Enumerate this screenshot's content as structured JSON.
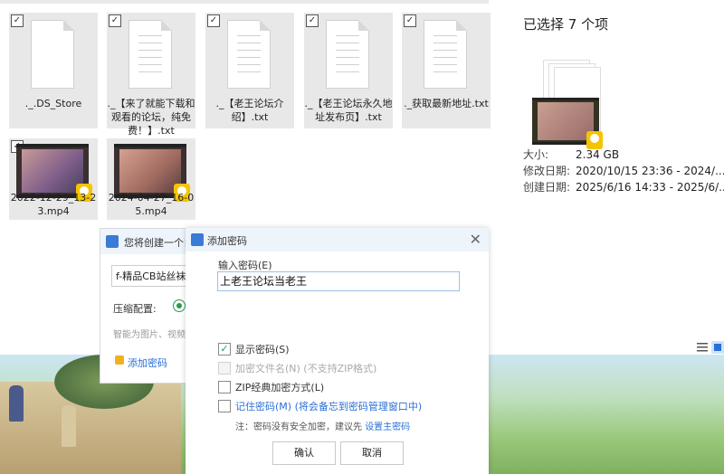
{
  "files": [
    {
      "name": "._.DS_Store",
      "type": "doc"
    },
    {
      "name": "._【来了就能下载和观看的论坛，纯免费！】.txt",
      "type": "doc"
    },
    {
      "name": "._【老王论坛介绍】.txt",
      "type": "doc"
    },
    {
      "name": "._【老王论坛永久地址发布页】.txt",
      "type": "doc"
    },
    {
      "name": "._获取最新地址.txt",
      "type": "doc"
    },
    {
      "name": "2022-12-29_13-23.mp4",
      "type": "video"
    },
    {
      "name": "2024-04-27_16-05.mp4",
      "type": "video"
    }
  ],
  "details": {
    "title": "已选择 7 个项",
    "size_label": "大小:",
    "size_value": "2.34 GB",
    "modified_label": "修改日期:",
    "modified_value": "2020/10/15 23:36 - 2024/...",
    "created_label": "创建日期:",
    "created_value": "2025/6/16 14:33 - 2025/6/..."
  },
  "archive_dialog": {
    "title": "您将创建一个日",
    "filename": "f-精品CB站丝袜",
    "compress_label": "压缩配置:",
    "hint": "智能为图片、视频",
    "add_password": "添加密码"
  },
  "password_dialog": {
    "title": "添加密码",
    "close": "✕",
    "input_label": "输入密码(E)",
    "password": "上老王论坛当老王",
    "options": [
      {
        "label": "显示密码(S)",
        "checked": true,
        "disabled": false
      },
      {
        "label": "加密文件名(N) (不支持ZIP格式)",
        "checked": false,
        "disabled": true
      },
      {
        "label": "ZIP经典加密方式(L)",
        "checked": false,
        "disabled": false
      },
      {
        "label": "记住密码(M) (将会备忘到密码管理窗口中)",
        "checked": false,
        "disabled": false
      }
    ],
    "note": "注：密码没有安全加密，建议先 ",
    "note_link": "设置主密码",
    "ok": "确认",
    "cancel": "取消"
  },
  "colors": {
    "accent": "#2a6fd6",
    "check": "#2a9a4a",
    "badge": "#f5c400"
  }
}
